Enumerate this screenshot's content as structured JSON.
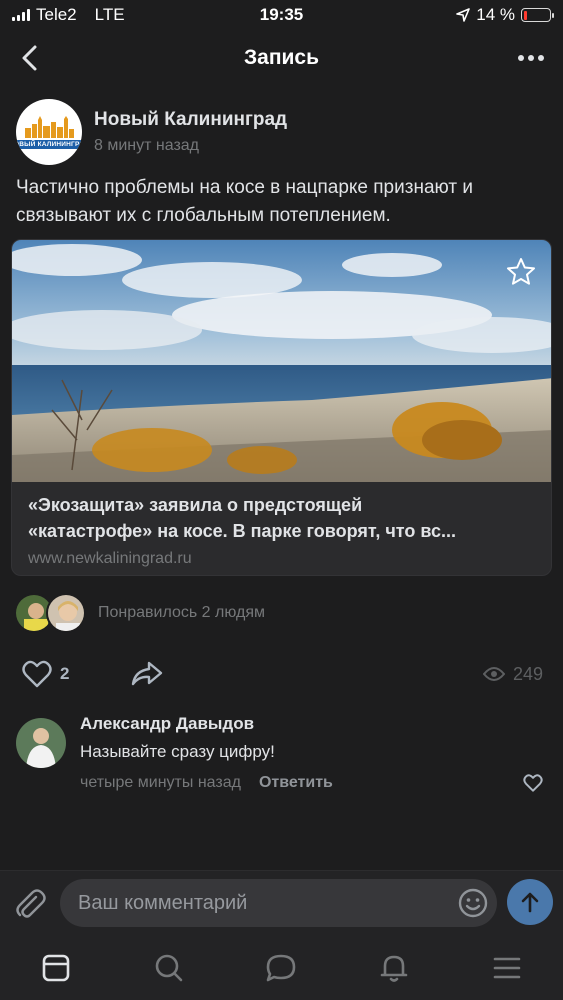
{
  "status_bar": {
    "carrier": "Tele2",
    "network": "LTE",
    "time": "19:35",
    "battery_percent": "14 %",
    "battery_level": 0.14
  },
  "nav": {
    "title": "Запись"
  },
  "post": {
    "group_name": "Новый Калининград",
    "group_logo_text": "НОВЫЙ КАЛИНИНГРАД",
    "time_ago": "8 минут назад",
    "text": "Частично проблемы на косе в нацпарке признают и связывают их с глобальным потеплением.",
    "link": {
      "title_line1": "«Экозащита» заявила о предстоящей",
      "title_line2": "«катастрофе» на косе. В парке говорят, что вс...",
      "url": "www.newkaliningrad.ru"
    },
    "likers_text": "Понравилось 2 людям",
    "likes_count": "2",
    "views_count": "249"
  },
  "comment": {
    "author": "Александр Давыдов",
    "text": "Называйте сразу цифру!",
    "time_ago": "четыре минуты назад",
    "reply_label": "Ответить"
  },
  "composer": {
    "placeholder": "Ваш комментарий"
  },
  "colors": {
    "background": "#1d1d1e",
    "accent": "#4a78ab",
    "secondary_text": "#76787a"
  },
  "icons": {
    "back": "chevron-left-icon",
    "more": "more-dots-icon",
    "favorite": "star-icon",
    "like": "heart-icon",
    "share": "share-icon",
    "views": "eye-icon",
    "attach": "paperclip-icon",
    "emoji": "smile-icon",
    "send": "arrow-up-icon",
    "tabs": [
      "feed-icon",
      "search-icon",
      "messages-icon",
      "notifications-icon",
      "menu-icon"
    ]
  }
}
